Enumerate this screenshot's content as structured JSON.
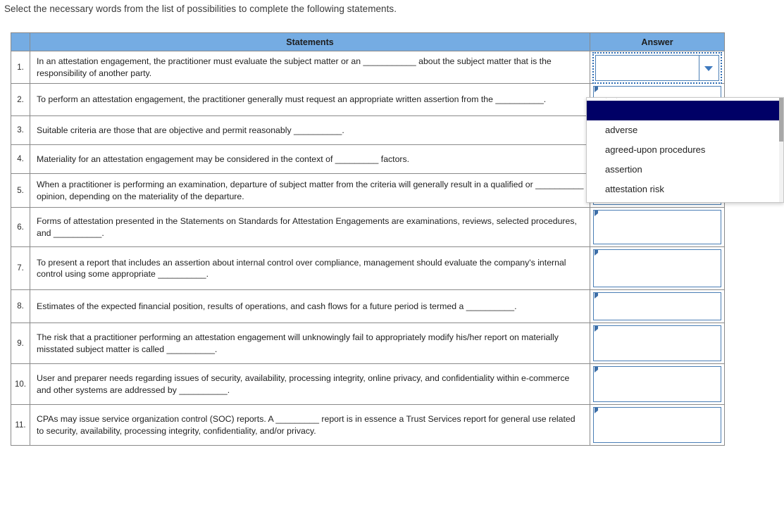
{
  "instruction": "Select the necessary words from the list of possibilities to complete the following statements.",
  "table": {
    "headers": {
      "number": "",
      "statements": "Statements",
      "answer": "Answer"
    },
    "rows": [
      {
        "num": "1.",
        "statement": "In an attestation engagement, the practitioner must evaluate the subject matter or an ___________ about the subject matter that is the responsibility of another party.",
        "answer": ""
      },
      {
        "num": "2.",
        "statement": "To perform an attestation engagement, the practitioner generally must request an appropriate written assertion from the __________.",
        "answer": ""
      },
      {
        "num": "3.",
        "statement": "Suitable criteria are those that are objective and permit reasonably __________.",
        "answer": ""
      },
      {
        "num": "4.",
        "statement": "Materiality for an attestation engagement may be considered in the context of _________ factors.",
        "answer": ""
      },
      {
        "num": "5.",
        "statement": "When a practitioner is performing an examination, departure of subject matter from the criteria will generally result in a qualified or __________ opinion, depending on the materiality of the departure.",
        "answer": ""
      },
      {
        "num": "6.",
        "statement": "Forms of attestation presented in the Statements on Standards for Attestation Engagements are examinations, reviews, selected procedures, and __________.",
        "answer": ""
      },
      {
        "num": "7.",
        "statement": "To present a report that includes an assertion about internal control over compliance, management should evaluate the company's internal control using some appropriate __________.",
        "answer": ""
      },
      {
        "num": "8.",
        "statement": "Estimates of the expected financial position, results of operations, and cash flows for a future period is termed a __________.",
        "answer": ""
      },
      {
        "num": "9.",
        "statement": "The risk that a practitioner performing an attestation engagement will unknowingly fail to appropriately modify his/her report on materially misstated subject matter is called __________.",
        "answer": ""
      },
      {
        "num": "10.",
        "statement": "User and preparer needs regarding issues of security, availability, processing integrity, online privacy, and confidentiality within e-commerce and other systems are addressed by __________.",
        "answer": ""
      },
      {
        "num": "11.",
        "statement": "CPAs may issue service organization control (SOC) reports. A _________ report is in essence a Trust Services report for general use related to security, availability, processing integrity, confidentiality, and/or privacy.",
        "answer": ""
      }
    ]
  },
  "dropdown": {
    "open_for_row": "1.",
    "options": [
      {
        "label": "",
        "selected": true
      },
      {
        "label": "adverse",
        "selected": false
      },
      {
        "label": "agreed-upon procedures",
        "selected": false
      },
      {
        "label": "assertion",
        "selected": false
      },
      {
        "label": "attestation risk",
        "selected": false
      }
    ]
  },
  "colors": {
    "header_blue": "#75ACE3",
    "selected_navy": "#000066",
    "control_border_blue": "#4A7EB5",
    "focus_ring_blue": "#2E6DB4",
    "grid_gray": "#8A8A8A"
  }
}
